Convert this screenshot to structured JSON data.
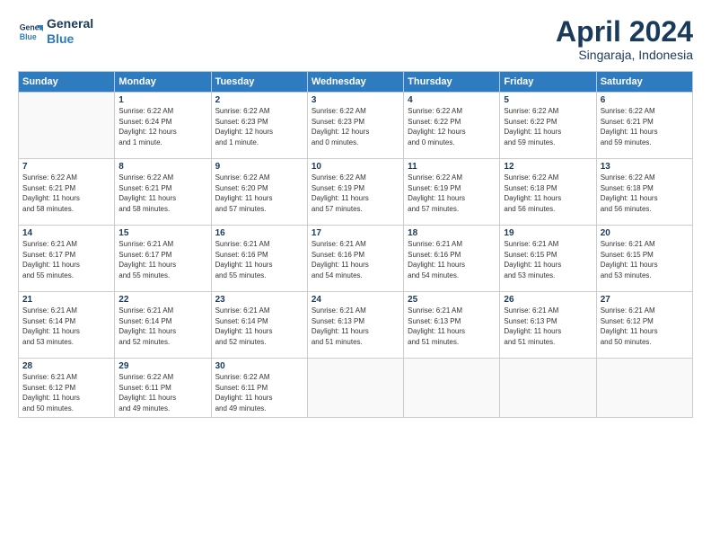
{
  "header": {
    "logo_line1": "General",
    "logo_line2": "Blue",
    "month_title": "April 2024",
    "subtitle": "Singaraja, Indonesia"
  },
  "days_of_week": [
    "Sunday",
    "Monday",
    "Tuesday",
    "Wednesday",
    "Thursday",
    "Friday",
    "Saturday"
  ],
  "weeks": [
    [
      {
        "day": "",
        "info": ""
      },
      {
        "day": "1",
        "info": "Sunrise: 6:22 AM\nSunset: 6:24 PM\nDaylight: 12 hours\nand 1 minute."
      },
      {
        "day": "2",
        "info": "Sunrise: 6:22 AM\nSunset: 6:23 PM\nDaylight: 12 hours\nand 1 minute."
      },
      {
        "day": "3",
        "info": "Sunrise: 6:22 AM\nSunset: 6:23 PM\nDaylight: 12 hours\nand 0 minutes."
      },
      {
        "day": "4",
        "info": "Sunrise: 6:22 AM\nSunset: 6:22 PM\nDaylight: 12 hours\nand 0 minutes."
      },
      {
        "day": "5",
        "info": "Sunrise: 6:22 AM\nSunset: 6:22 PM\nDaylight: 11 hours\nand 59 minutes."
      },
      {
        "day": "6",
        "info": "Sunrise: 6:22 AM\nSunset: 6:21 PM\nDaylight: 11 hours\nand 59 minutes."
      }
    ],
    [
      {
        "day": "7",
        "info": "Sunrise: 6:22 AM\nSunset: 6:21 PM\nDaylight: 11 hours\nand 58 minutes."
      },
      {
        "day": "8",
        "info": "Sunrise: 6:22 AM\nSunset: 6:21 PM\nDaylight: 11 hours\nand 58 minutes."
      },
      {
        "day": "9",
        "info": "Sunrise: 6:22 AM\nSunset: 6:20 PM\nDaylight: 11 hours\nand 57 minutes."
      },
      {
        "day": "10",
        "info": "Sunrise: 6:22 AM\nSunset: 6:19 PM\nDaylight: 11 hours\nand 57 minutes."
      },
      {
        "day": "11",
        "info": "Sunrise: 6:22 AM\nSunset: 6:19 PM\nDaylight: 11 hours\nand 57 minutes."
      },
      {
        "day": "12",
        "info": "Sunrise: 6:22 AM\nSunset: 6:18 PM\nDaylight: 11 hours\nand 56 minutes."
      },
      {
        "day": "13",
        "info": "Sunrise: 6:22 AM\nSunset: 6:18 PM\nDaylight: 11 hours\nand 56 minutes."
      }
    ],
    [
      {
        "day": "14",
        "info": "Sunrise: 6:21 AM\nSunset: 6:17 PM\nDaylight: 11 hours\nand 55 minutes."
      },
      {
        "day": "15",
        "info": "Sunrise: 6:21 AM\nSunset: 6:17 PM\nDaylight: 11 hours\nand 55 minutes."
      },
      {
        "day": "16",
        "info": "Sunrise: 6:21 AM\nSunset: 6:16 PM\nDaylight: 11 hours\nand 55 minutes."
      },
      {
        "day": "17",
        "info": "Sunrise: 6:21 AM\nSunset: 6:16 PM\nDaylight: 11 hours\nand 54 minutes."
      },
      {
        "day": "18",
        "info": "Sunrise: 6:21 AM\nSunset: 6:16 PM\nDaylight: 11 hours\nand 54 minutes."
      },
      {
        "day": "19",
        "info": "Sunrise: 6:21 AM\nSunset: 6:15 PM\nDaylight: 11 hours\nand 53 minutes."
      },
      {
        "day": "20",
        "info": "Sunrise: 6:21 AM\nSunset: 6:15 PM\nDaylight: 11 hours\nand 53 minutes."
      }
    ],
    [
      {
        "day": "21",
        "info": "Sunrise: 6:21 AM\nSunset: 6:14 PM\nDaylight: 11 hours\nand 53 minutes."
      },
      {
        "day": "22",
        "info": "Sunrise: 6:21 AM\nSunset: 6:14 PM\nDaylight: 11 hours\nand 52 minutes."
      },
      {
        "day": "23",
        "info": "Sunrise: 6:21 AM\nSunset: 6:14 PM\nDaylight: 11 hours\nand 52 minutes."
      },
      {
        "day": "24",
        "info": "Sunrise: 6:21 AM\nSunset: 6:13 PM\nDaylight: 11 hours\nand 51 minutes."
      },
      {
        "day": "25",
        "info": "Sunrise: 6:21 AM\nSunset: 6:13 PM\nDaylight: 11 hours\nand 51 minutes."
      },
      {
        "day": "26",
        "info": "Sunrise: 6:21 AM\nSunset: 6:13 PM\nDaylight: 11 hours\nand 51 minutes."
      },
      {
        "day": "27",
        "info": "Sunrise: 6:21 AM\nSunset: 6:12 PM\nDaylight: 11 hours\nand 50 minutes."
      }
    ],
    [
      {
        "day": "28",
        "info": "Sunrise: 6:21 AM\nSunset: 6:12 PM\nDaylight: 11 hours\nand 50 minutes."
      },
      {
        "day": "29",
        "info": "Sunrise: 6:22 AM\nSunset: 6:11 PM\nDaylight: 11 hours\nand 49 minutes."
      },
      {
        "day": "30",
        "info": "Sunrise: 6:22 AM\nSunset: 6:11 PM\nDaylight: 11 hours\nand 49 minutes."
      },
      {
        "day": "",
        "info": ""
      },
      {
        "day": "",
        "info": ""
      },
      {
        "day": "",
        "info": ""
      },
      {
        "day": "",
        "info": ""
      }
    ]
  ]
}
